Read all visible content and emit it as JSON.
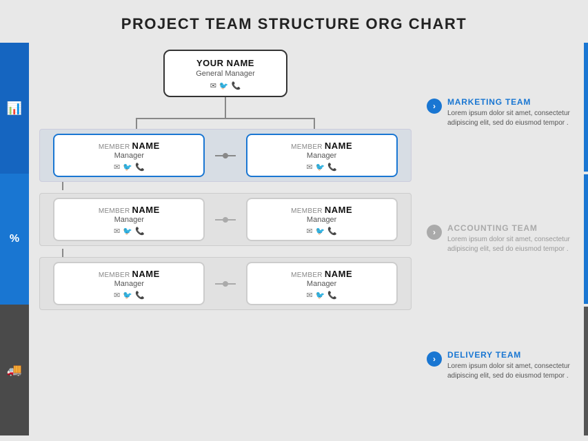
{
  "title": "PROJECT TEAM STRUCTURE ORG CHART",
  "topNode": {
    "name": "YOUR NAME",
    "title": "General Manager",
    "icons": [
      "✉",
      "🐦",
      "📞"
    ]
  },
  "rows": [
    {
      "type": "row1",
      "nodes": [
        {
          "memberLabel": "MEMBER",
          "memberName": "NAME",
          "title": "Manager",
          "blueBorder": true,
          "icons": [
            "✉",
            "🐦",
            "📞"
          ]
        },
        {
          "memberLabel": "MEMBER",
          "memberName": "NAME",
          "title": "Manager",
          "blueBorder": true,
          "icons": [
            "✉",
            "🐦",
            "📞"
          ]
        }
      ]
    },
    {
      "type": "row2",
      "nodes": [
        {
          "memberLabel": "MEMBER",
          "memberName": "NAME",
          "title": "Manager",
          "blueBorder": false,
          "icons": [
            "✉",
            "🐦",
            "📞"
          ]
        },
        {
          "memberLabel": "MEMBER",
          "memberName": "NAME",
          "title": "Manager",
          "blueBorder": false,
          "icons": [
            "✉",
            "🐦",
            "📞"
          ]
        }
      ]
    },
    {
      "type": "row3",
      "nodes": [
        {
          "memberLabel": "MEMBER",
          "memberName": "NAME",
          "title": "Manager",
          "blueBorder": false,
          "icons": [
            "✉",
            "🐦",
            "📞"
          ]
        },
        {
          "memberLabel": "MEMBER",
          "memberName": "NAME",
          "title": "Manager",
          "blueBorder": false,
          "icons": [
            "✉",
            "🐦",
            "📞"
          ]
        }
      ]
    }
  ],
  "sideIcons": [
    {
      "symbol": "📊",
      "color": "blue"
    },
    {
      "symbol": "%",
      "color": "mid"
    },
    {
      "symbol": "🚚",
      "color": "dark"
    }
  ],
  "infoBlocks": [
    {
      "id": "marketing",
      "title": "MARKETING TEAM",
      "titleColor": "blue",
      "chevronColor": "blue",
      "desc": "Lorem ipsum dolor sit amet, consectetur adipiscing elit, sed do eiusmod tempor ."
    },
    {
      "id": "accounting",
      "title": "ACCOUNTING TEAM",
      "titleColor": "gray",
      "chevronColor": "gray",
      "desc": "Lorem ipsum dolor sit amet, consectetur adipiscing elit, sed do eiusmod tempor ."
    },
    {
      "id": "delivery",
      "title": "DELIVERY TEAM",
      "titleColor": "blue",
      "chevronColor": "blue2",
      "desc": "Lorem ipsum dolor sit amet, consectetur adipiscing elit, sed do eiusmod tempor ."
    }
  ]
}
